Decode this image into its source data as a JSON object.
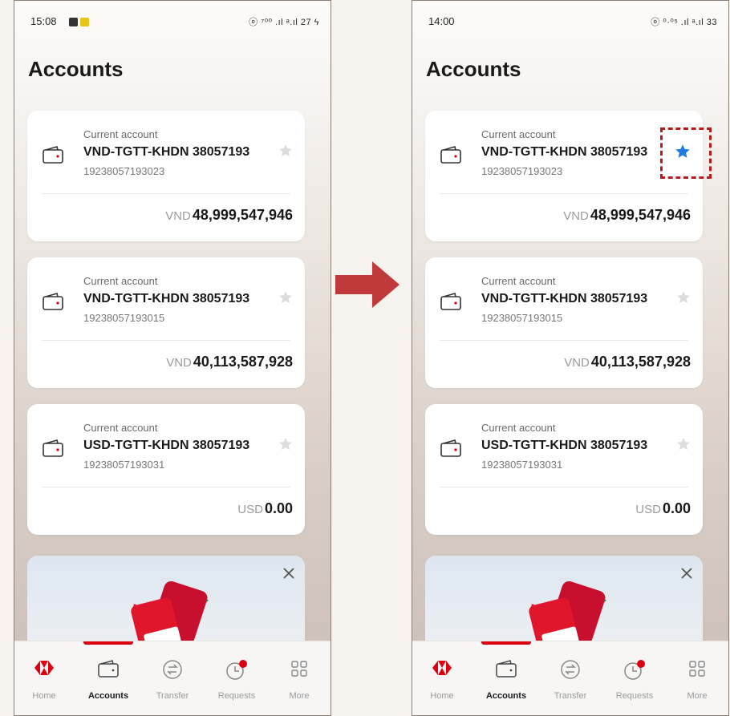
{
  "colors": {
    "brand_red": "#db0011",
    "star_active": "#1e7be0",
    "star_inactive": "#dcdcdc",
    "highlight": "#b71c1c",
    "arrow": "#c0393b"
  },
  "screens": [
    {
      "status": {
        "time": "15:08",
        "right": "ⓞ ⁷⁰⁰ .ıl ᵃ.ıl 27 ϟ"
      },
      "title": "Accounts",
      "accounts": [
        {
          "type": "Current account",
          "name": "VND-TGTT-KHDN 38057193",
          "number": "19238057193023",
          "currency": "VND",
          "balance": "48,999,547,946",
          "favorite": false
        },
        {
          "type": "Current account",
          "name": "VND-TGTT-KHDN 38057193",
          "number": "19238057193015",
          "currency": "VND",
          "balance": "40,113,587,928",
          "favorite": false
        },
        {
          "type": "Current account",
          "name": "USD-TGTT-KHDN 38057193",
          "number": "19238057193031",
          "currency": "USD",
          "balance": "0.00",
          "favorite": false
        }
      ],
      "nav": [
        {
          "label": "Home",
          "icon": "home-logo-icon"
        },
        {
          "label": "Accounts",
          "icon": "wallet-icon",
          "active": true
        },
        {
          "label": "Transfer",
          "icon": "transfer-icon"
        },
        {
          "label": "Requests",
          "icon": "clock-icon"
        },
        {
          "label": "More",
          "icon": "grid-icon"
        }
      ]
    },
    {
      "status": {
        "time": "14:00",
        "right": "ⓞ ⁰·⁰⁵ .ıl ᵃ.ıl 33"
      },
      "title": "Accounts",
      "accounts": [
        {
          "type": "Current account",
          "name": "VND-TGTT-KHDN 38057193",
          "number": "19238057193023",
          "currency": "VND",
          "balance": "48,999,547,946",
          "favorite": true
        },
        {
          "type": "Current account",
          "name": "VND-TGTT-KHDN 38057193",
          "number": "19238057193015",
          "currency": "VND",
          "balance": "40,113,587,928",
          "favorite": false
        },
        {
          "type": "Current account",
          "name": "USD-TGTT-KHDN 38057193",
          "number": "19238057193031",
          "currency": "USD",
          "balance": "0.00",
          "favorite": false
        }
      ],
      "nav": [
        {
          "label": "Home",
          "icon": "home-logo-icon"
        },
        {
          "label": "Accounts",
          "icon": "wallet-icon",
          "active": true
        },
        {
          "label": "Transfer",
          "icon": "transfer-icon"
        },
        {
          "label": "Requests",
          "icon": "clock-icon"
        },
        {
          "label": "More",
          "icon": "grid-icon"
        }
      ]
    }
  ]
}
